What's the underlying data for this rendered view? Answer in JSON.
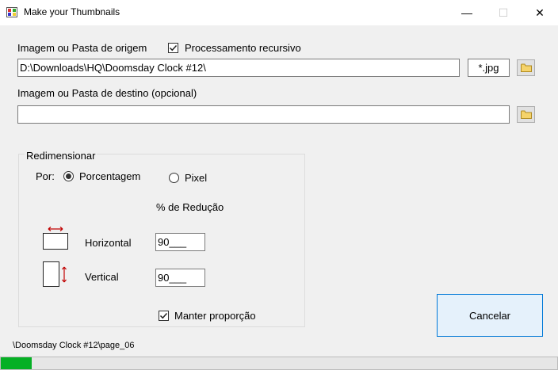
{
  "window": {
    "title": "Make your Thumbnails",
    "minimize": "—",
    "maximize": "☐",
    "close": "✕"
  },
  "source": {
    "label": "Imagem ou Pasta de origem",
    "recursive_label": "Processamento recursivo",
    "recursive_checked": true,
    "path_value": "D:\\Downloads\\HQ\\Doomsday Clock #12\\",
    "filter_value": "*.jpg"
  },
  "destination": {
    "label": "Imagem ou Pasta de destino (opcional)",
    "path_value": ""
  },
  "resize": {
    "group_title": "Redimensionar",
    "by_label": "Por:",
    "option_percent": "Porcentagem",
    "option_pixel": "Pixel",
    "selected": "percent",
    "reduction_header": "% de Redução",
    "horizontal_label": "Horizontal",
    "horizontal_value": "90___",
    "vertical_label": "Vertical",
    "vertical_value": "90___",
    "keep_ratio_label": "Manter proporção",
    "keep_ratio_checked": true
  },
  "actions": {
    "cancel_label": "Cancelar"
  },
  "status": {
    "current_file": "\\Doomsday Clock #12\\page_06",
    "progress_fraction": 0.055
  },
  "colors": {
    "progress_fill": "#06b025",
    "accent_border": "#0078d7",
    "arrow_red": "#c00000"
  }
}
